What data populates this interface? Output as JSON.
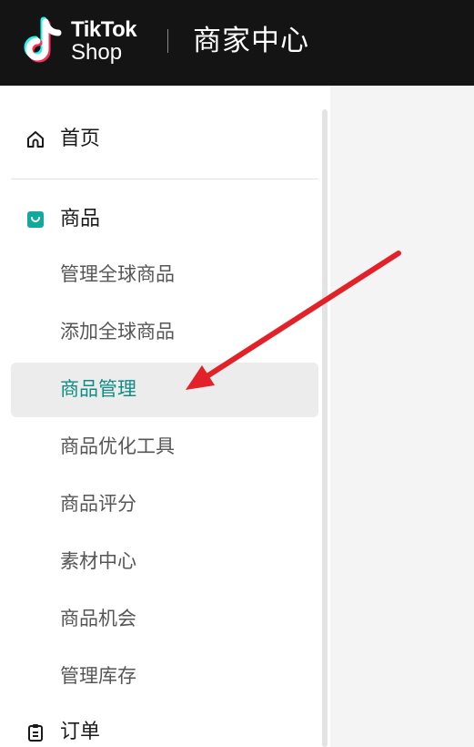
{
  "header": {
    "brand_line1": "TikTok",
    "brand_line2": "Shop",
    "title": "商家中心"
  },
  "sidebar": {
    "home": {
      "label": "首页",
      "icon": "home-icon"
    },
    "products": {
      "label": "商品",
      "icon": "shopping-bag-icon",
      "icon_color": "#12a89d",
      "items": [
        {
          "label": "管理全球商品",
          "active": false
        },
        {
          "label": "添加全球商品",
          "active": false
        },
        {
          "label": "商品管理",
          "active": true
        },
        {
          "label": "商品优化工具",
          "active": false
        },
        {
          "label": "商品评分",
          "active": false
        },
        {
          "label": "素材中心",
          "active": false
        },
        {
          "label": "商品机会",
          "active": false
        },
        {
          "label": "管理库存",
          "active": false
        }
      ]
    },
    "orders": {
      "label": "订单",
      "icon": "clipboard-icon"
    }
  },
  "colors": {
    "topbar": "#141414",
    "active_text": "#0f8d84",
    "active_bg": "#ececec",
    "annotation_arrow": "#e32128"
  },
  "annotation": {
    "icon": "red-arrow-icon",
    "points_to": "商品管理"
  }
}
